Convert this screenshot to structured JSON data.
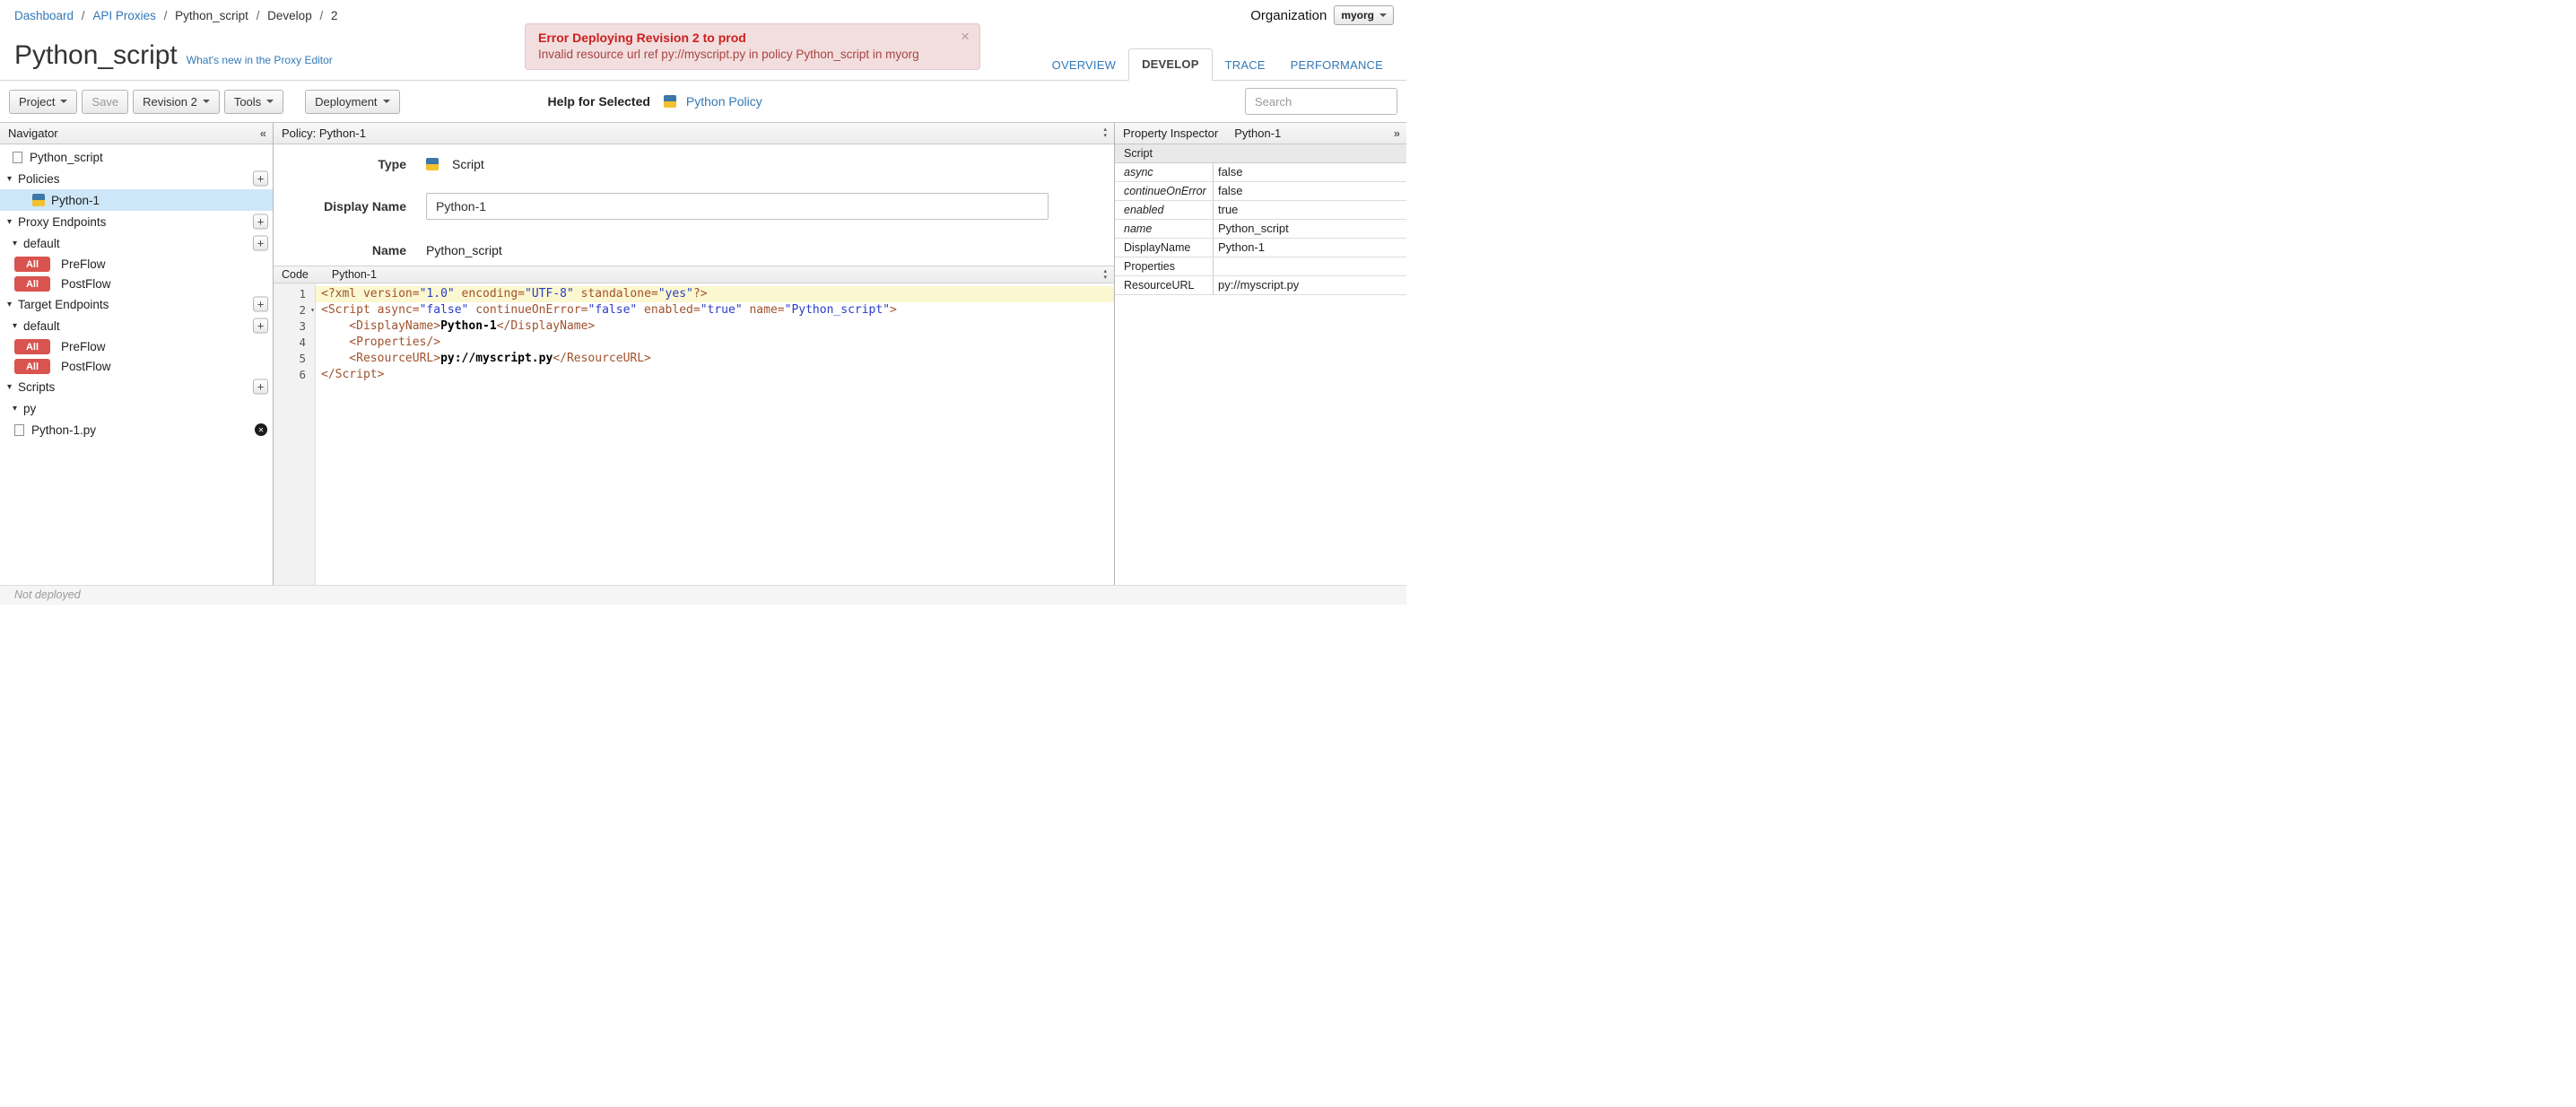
{
  "colors": {
    "link": "#3379b7",
    "error_bg": "#f2dede",
    "error_title": "#cc1f1f",
    "error_text": "#a94442",
    "badge": "#d9534f",
    "selected_row": "#cde7f8",
    "code_tag": "#a0522d",
    "code_string": "#2a3cc9",
    "line_highlight": "#fbf7d0"
  },
  "breadcrumb": {
    "separator": "/",
    "items": [
      {
        "label": "Dashboard",
        "link": true
      },
      {
        "label": "API Proxies",
        "link": true
      },
      {
        "label": "Python_script",
        "link": false
      },
      {
        "label": "Develop",
        "link": false
      },
      {
        "label": "2",
        "link": false
      }
    ]
  },
  "organization": {
    "label": "Organization",
    "value": "myorg"
  },
  "error_banner": {
    "title": "Error Deploying Revision 2 to prod",
    "message": "Invalid resource url ref py://myscript.py in policy Python_script in myorg",
    "close": "×"
  },
  "page": {
    "title": "Python_script",
    "whats_new_link": "What's new in the Proxy Editor"
  },
  "tabs": [
    {
      "label": "OVERVIEW",
      "active": false
    },
    {
      "label": "DEVELOP",
      "active": true
    },
    {
      "label": "TRACE",
      "active": false
    },
    {
      "label": "PERFORMANCE",
      "active": false
    }
  ],
  "toolbar": {
    "project_label": "Project",
    "save_label": "Save",
    "revision_label": "Revision 2",
    "tools_label": "Tools",
    "deployment_label": "Deployment",
    "help_for_selected_label": "Help for Selected",
    "policy_link_label": "Python Policy",
    "search_placeholder": "Search"
  },
  "navigator": {
    "title": "Navigator",
    "collapse_icon": "«",
    "items": [
      {
        "kind": "file",
        "label": "Python_script",
        "level": 0
      },
      {
        "kind": "section",
        "label": "Policies",
        "level": 0,
        "add": true
      },
      {
        "kind": "policy",
        "label": "Python-1",
        "selected": true
      },
      {
        "kind": "section",
        "label": "Proxy Endpoints",
        "level": 0,
        "add": true
      },
      {
        "kind": "section",
        "label": "default",
        "level": 1,
        "add": true
      },
      {
        "kind": "flow",
        "badge": "All",
        "label": "PreFlow"
      },
      {
        "kind": "flow",
        "badge": "All",
        "label": "PostFlow"
      },
      {
        "kind": "section",
        "label": "Target Endpoints",
        "level": 0,
        "add": true
      },
      {
        "kind": "section",
        "label": "default",
        "level": 1,
        "add": true
      },
      {
        "kind": "flow",
        "badge": "All",
        "label": "PreFlow"
      },
      {
        "kind": "flow",
        "badge": "All",
        "label": "PostFlow"
      },
      {
        "kind": "section",
        "label": "Scripts",
        "level": 0,
        "add": true
      },
      {
        "kind": "section",
        "label": "py",
        "level": 1
      },
      {
        "kind": "file",
        "label": "Python-1.py",
        "level": 1,
        "deletable": true
      }
    ]
  },
  "policy_panel": {
    "header": "Policy: Python-1",
    "type_label": "Type",
    "type_value": "Script",
    "display_name_label": "Display Name",
    "display_name_value": "Python-1",
    "name_label": "Name",
    "name_value": "Python_script"
  },
  "code_panel": {
    "header_label": "Code",
    "file_name": "Python-1",
    "lines": [
      {
        "num": 1,
        "highlight": true,
        "tokens": [
          {
            "c": "tag",
            "t": "<?xml "
          },
          {
            "c": "tag",
            "t": "version="
          },
          {
            "c": "str",
            "t": "\"1.0\""
          },
          {
            "c": "tag",
            "t": " encoding="
          },
          {
            "c": "str",
            "t": "\"UTF-8\""
          },
          {
            "c": "tag",
            "t": " standalone="
          },
          {
            "c": "str",
            "t": "\"yes\""
          },
          {
            "c": "tag",
            "t": "?>"
          }
        ]
      },
      {
        "num": 2,
        "fold": true,
        "tokens": [
          {
            "c": "tag",
            "t": "<Script async="
          },
          {
            "c": "str",
            "t": "\"false\""
          },
          {
            "c": "tag",
            "t": " continueOnError="
          },
          {
            "c": "str",
            "t": "\"false\""
          },
          {
            "c": "tag",
            "t": " enabled="
          },
          {
            "c": "str",
            "t": "\"true\""
          },
          {
            "c": "tag",
            "t": " name="
          },
          {
            "c": "str",
            "t": "\"Python_script\""
          },
          {
            "c": "tag",
            "t": ">"
          }
        ]
      },
      {
        "num": 3,
        "tokens": [
          {
            "c": "tag",
            "t": "    <DisplayName>"
          },
          {
            "c": "txt",
            "t": "Python-1"
          },
          {
            "c": "tag",
            "t": "</DisplayName>"
          }
        ]
      },
      {
        "num": 4,
        "tokens": [
          {
            "c": "tag",
            "t": "    <Properties/>"
          }
        ]
      },
      {
        "num": 5,
        "tokens": [
          {
            "c": "tag",
            "t": "    <ResourceURL>"
          },
          {
            "c": "txt",
            "t": "py://myscript.py"
          },
          {
            "c": "tag",
            "t": "</ResourceURL>"
          }
        ]
      },
      {
        "num": 6,
        "tokens": [
          {
            "c": "tag",
            "t": "</Script>"
          }
        ]
      }
    ]
  },
  "property_inspector": {
    "title": "Property Inspector",
    "subtitle": "Python-1",
    "expand_icon": "»",
    "section_header": "Script",
    "rows": [
      {
        "key": "async",
        "value": "false",
        "italic": true
      },
      {
        "key": "continueOnError",
        "value": "false",
        "italic": true
      },
      {
        "key": "enabled",
        "value": "true",
        "italic": true
      },
      {
        "key": "name",
        "value": "Python_script",
        "italic": true
      },
      {
        "key": "DisplayName",
        "value": "Python-1",
        "italic": false
      },
      {
        "key": "Properties",
        "value": "",
        "italic": false
      },
      {
        "key": "ResourceURL",
        "value": "py://myscript.py",
        "italic": false
      }
    ]
  },
  "status_bar": {
    "text": "Not deployed"
  }
}
